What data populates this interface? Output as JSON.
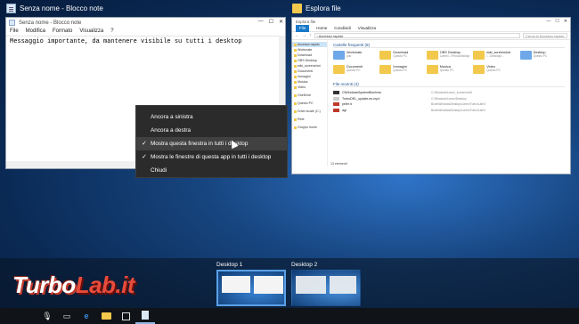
{
  "notepad_label": "Senza nome - Blocco note",
  "explorer_label": "Esplora file",
  "notepad": {
    "title": "Senza nome - Blocco note",
    "menu": [
      "File",
      "Modifica",
      "Formato",
      "Visualizza",
      "?"
    ],
    "text": "Messaggio importante, da mantenere visibile su tutti i desktop"
  },
  "explorer": {
    "title": "Esplora file",
    "ribbon": [
      "File",
      "Home",
      "Condividi",
      "Visualizza"
    ],
    "address": "› Accesso rapido",
    "search_placeholder": "Cerca in Accesso rapido",
    "nav": [
      "Accesso rapido",
      "Workmate",
      "Download",
      "OBS Desktop",
      "wiki_screenshot",
      "Documenti",
      "Immagini",
      "Musica",
      "Video",
      "OneDrive",
      "Questo PC",
      "Drive locale (C:)",
      "Rete",
      "Gruppo home"
    ],
    "frequent_header": "Cartelle frequenti (8)",
    "frequent": [
      {
        "name": "Workmate",
        "sub": "pub"
      },
      {
        "name": "Download",
        "sub": "Questo PC"
      },
      {
        "name": "OBS Desktop",
        "sub": "Lorem\\...\\PhotoDesktop"
      },
      {
        "name": "wiki_screenshot",
        "sub": "\\...\\Desktop\\..."
      },
      {
        "name": "Desktop",
        "sub": "Questo PC"
      },
      {
        "name": "Documenti",
        "sub": "Questo PC"
      },
      {
        "name": "Immagini",
        "sub": "Questo PC"
      },
      {
        "name": "Musica",
        "sub": "Questo PC"
      },
      {
        "name": "Video",
        "sub": "Questo PC"
      }
    ],
    "recent_header": "File recenti (4)",
    "recent": [
      {
        "name": "ClWindowsSystemBluehrav",
        "path": "C:\\Windows\\Lorem_screenshot3"
      },
      {
        "name": "TurboDEL_update-es.mp4",
        "path": "C:\\Windows\\Lorem\\Desktop"
      },
      {
        "name": "peter.it",
        "path": "Burst\\WindowsDesktop\\Lorem\\Turbo\\Lab\\it"
      },
      {
        "name": "agi",
        "path": "Burst\\WindowsDesktop\\Lorem\\Turbo\\Lab\\it"
      }
    ],
    "status": "13 elementi"
  },
  "context_menu": {
    "items": [
      {
        "label": "Ancora a sinistra",
        "checked": false
      },
      {
        "label": "Ancora a destra",
        "checked": false
      },
      {
        "label": "Mostra questa finestra in tutti i desktop",
        "checked": true
      },
      {
        "label": "Mostra le finestre di questa app in tutti i desktop",
        "checked": true
      },
      {
        "label": "Chiudi",
        "checked": false
      }
    ],
    "check_glyph": "✓"
  },
  "desktops": [
    {
      "label": "Desktop 1"
    },
    {
      "label": "Desktop 2"
    }
  ],
  "watermark": {
    "left": "Turbo",
    "right": "Lab.it"
  },
  "colors": {
    "accent": "#1979ca",
    "desktop_highlight": "#5aa0e6"
  }
}
